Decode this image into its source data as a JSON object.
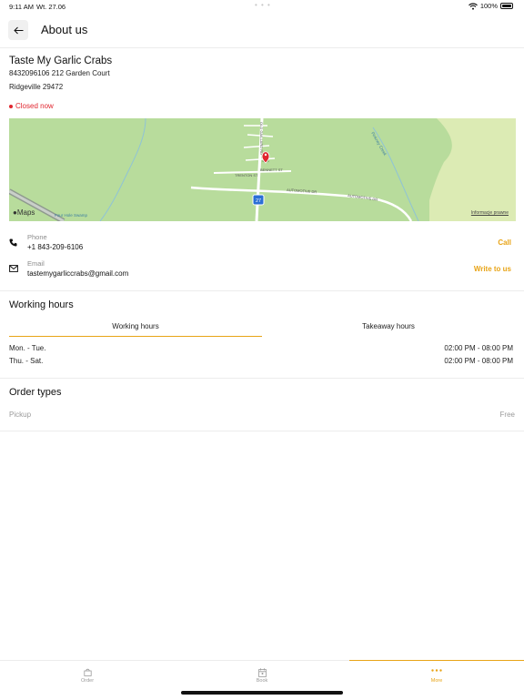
{
  "status": {
    "time": "9:11 AM",
    "date": "Wt. 27.06",
    "battery": "100%"
  },
  "header": {
    "title": "About us"
  },
  "venue": {
    "name": "Taste My Garlic Crabs",
    "address_line1": "8432096106 212 Garden Court",
    "address_line2": "Ridgeville 29472",
    "status": "Closed now"
  },
  "map": {
    "brand": "Maps",
    "legal": "Informacje prawne",
    "route_shield": "27",
    "street_labels": [
      "OLD GAILLARD RD",
      "AUTOMOTIVE DR",
      "AUTOMOTIVE DR",
      "TRENTON ST",
      "BENNETT ST",
      "Four Hole Swamp",
      "Pinkney Creek"
    ]
  },
  "contact": {
    "phone_label": "Phone",
    "phone_value": "+1 843-209-6106",
    "phone_action": "Call",
    "email_label": "Email",
    "email_value": "tastemygarliccrabs@gmail.com",
    "email_action": "Write to us"
  },
  "working_hours": {
    "title": "Working hours",
    "tabs": [
      {
        "label": "Working hours",
        "active": true
      },
      {
        "label": "Takeaway hours",
        "active": false
      }
    ],
    "rows": [
      {
        "days": "Mon. - Tue.",
        "hours": "02:00 PM - 08:00 PM"
      },
      {
        "days": "Thu. - Sat.",
        "hours": "02:00 PM - 08:00 PM"
      }
    ]
  },
  "order_types": {
    "title": "Order types",
    "items": [
      {
        "name": "Pickup",
        "price": "Free"
      }
    ]
  },
  "nav": {
    "items": [
      {
        "label": "Order",
        "icon": "bag-icon"
      },
      {
        "label": "Book",
        "icon": "calendar-icon"
      },
      {
        "label": "More",
        "icon": "more-dots-icon"
      }
    ]
  },
  "colors": {
    "accent": "#e8a417",
    "closed": "#e0262f",
    "map_land": "#b8dc9c"
  }
}
